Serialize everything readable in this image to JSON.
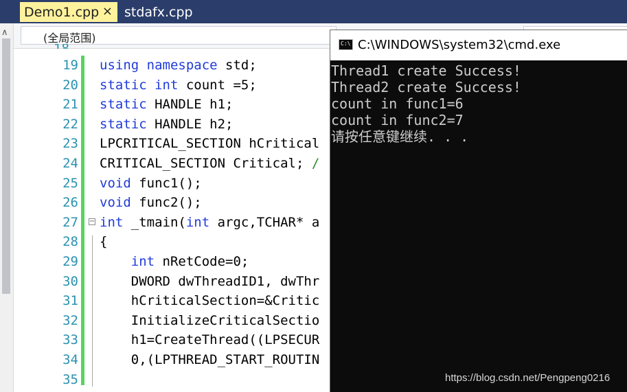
{
  "ide": {
    "tabs": [
      {
        "label": "Demo1.cpp",
        "close": "×",
        "active": true
      },
      {
        "label": "stdafx.cpp",
        "active": false
      }
    ],
    "scope_dropdown": "(全局范围)",
    "lines": [
      {
        "no": "19",
        "text": "using namespace std;"
      },
      {
        "no": "20",
        "text": "static int count =5;"
      },
      {
        "no": "21",
        "text": "static HANDLE h1;"
      },
      {
        "no": "22",
        "text": "static HANDLE h2;"
      },
      {
        "no": "23",
        "text": "LPCRITICAL_SECTION hCritical"
      },
      {
        "no": "24",
        "text": "CRITICAL_SECTION Critical; /"
      },
      {
        "no": "25",
        "text": "void func1();"
      },
      {
        "no": "26",
        "text": "void func2();"
      },
      {
        "no": "27",
        "text": "int _tmain(int argc,TCHAR* a"
      },
      {
        "no": "28",
        "text": "{"
      },
      {
        "no": "29",
        "text": "    int nRetCode=0;"
      },
      {
        "no": "30",
        "text": "    DWORD dwThreadID1, dwThr"
      },
      {
        "no": "31",
        "text": "    hCriticalSection=&Critic"
      },
      {
        "no": "32",
        "text": "    InitializeCriticalSectio"
      },
      {
        "no": "33",
        "text": "    h1=CreateThread((LPSECUR"
      },
      {
        "no": "34",
        "text": "    0,(LPTHREAD_START_ROUTIN"
      },
      {
        "no": "35",
        "text": ""
      }
    ]
  },
  "cmd": {
    "title": "C:\\WINDOWS\\system32\\cmd.exe",
    "icon": "C:\\",
    "output": [
      "Thread1 create Success!",
      "Thread2 create Success!",
      "count in func1=6",
      "count in func2=7",
      "请按任意键继续. . ."
    ]
  },
  "watermark": "https://blog.csdn.net/Pengpeng0216",
  "colors": {
    "tabbar": "#2B3E6B",
    "active_tab": "#FFF29D",
    "keyword": "#1F3BD9",
    "line_number": "#2B91AF",
    "change_bar": "#57D35F",
    "console_bg": "#0C0C0C",
    "console_text": "#CCCCCC"
  }
}
